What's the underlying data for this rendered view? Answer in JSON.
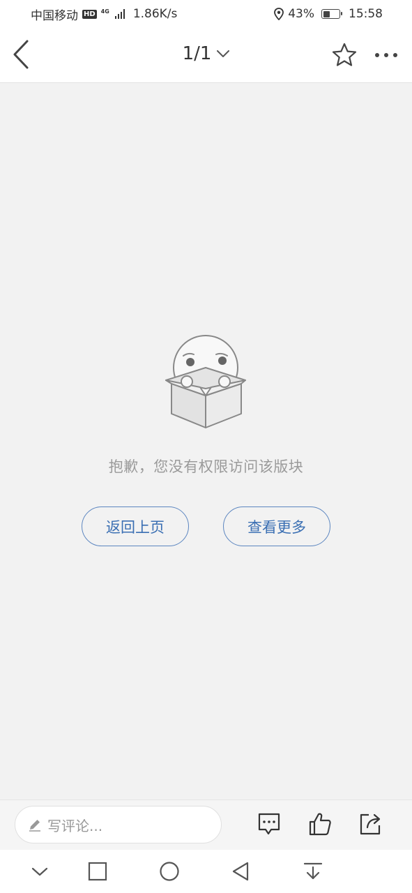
{
  "status_bar": {
    "carrier": "中国移动",
    "hd": "HD",
    "network": "4G",
    "speed": "1.86K/s",
    "battery_percent": "43%",
    "battery_level": 0.43,
    "time": "15:58"
  },
  "nav": {
    "page_indicator": "1/1",
    "icons": [
      "back-arrow-icon",
      "chevron-down-icon",
      "star-icon",
      "more-icon"
    ]
  },
  "content": {
    "message": "抱歉，您没有权限访问该版块",
    "back_button": "返回上页",
    "more_button": "查看更多"
  },
  "bottom_bar": {
    "comment_placeholder": "写评论..."
  },
  "colors": {
    "accent": "#3a6fb3",
    "background": "#f2f2f2",
    "message_text": "#9a9a9a"
  }
}
